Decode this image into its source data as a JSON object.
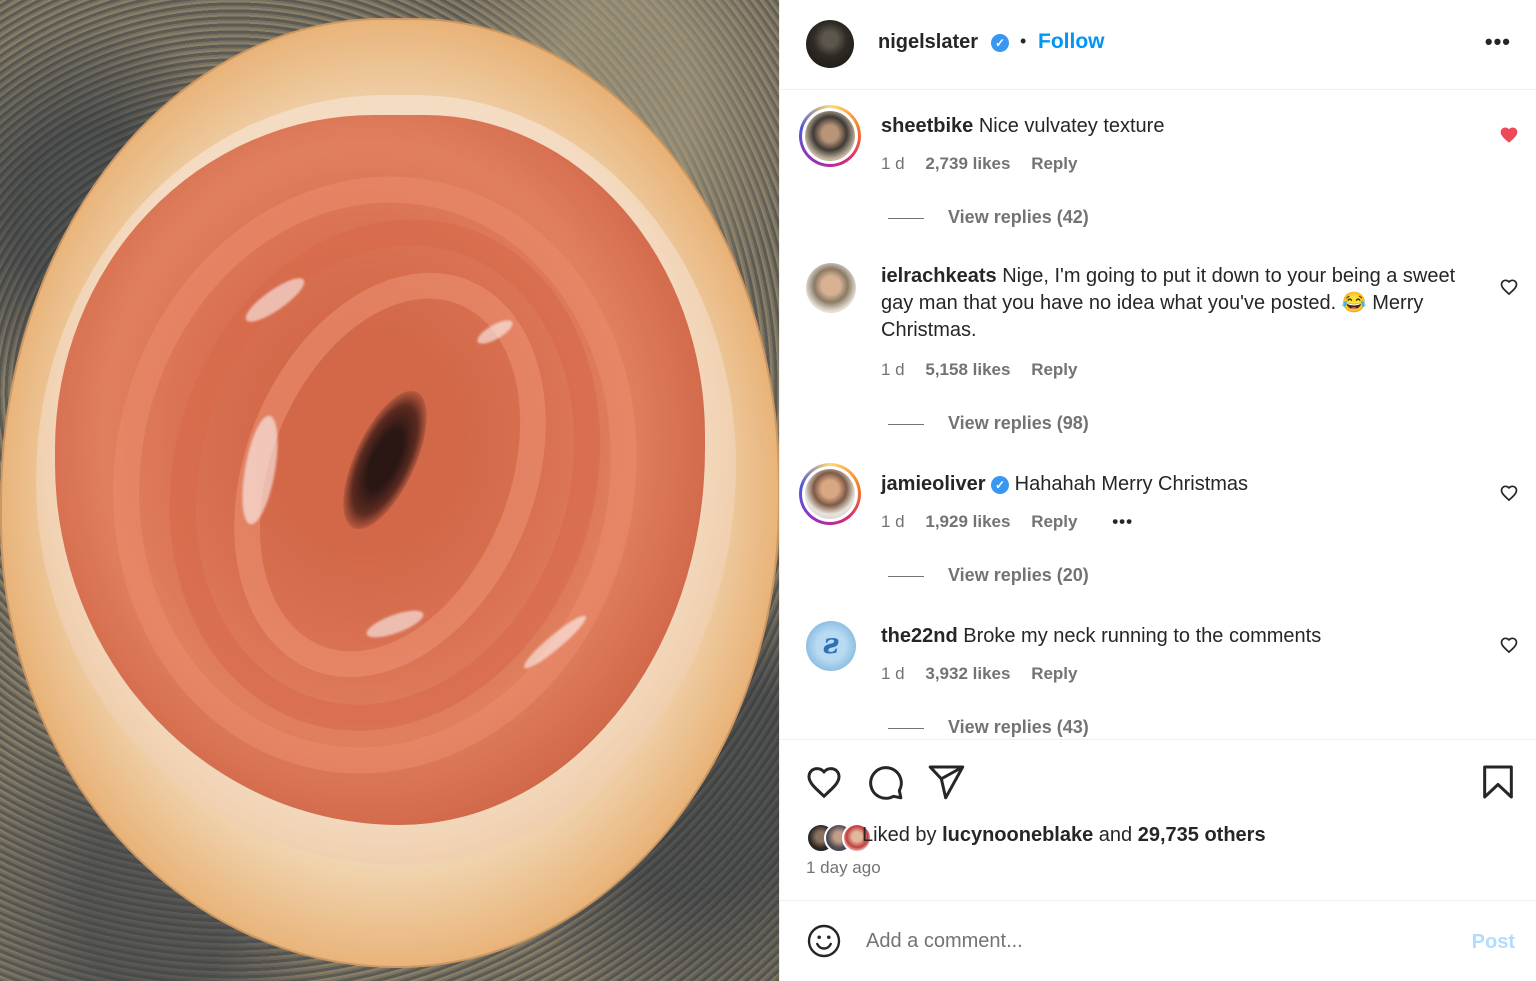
{
  "post": {
    "author": "nigelslater",
    "follow_label": "Follow",
    "separator": "•",
    "more_label": "•••"
  },
  "comments": [
    {
      "username": "sheetbike",
      "text": "Nice vulvatey texture",
      "time": "1 d",
      "likes": "2,739 likes",
      "reply_label": "Reply",
      "view_replies": "View replies (42)",
      "liked": true
    },
    {
      "username": "ielrachkeats",
      "text": "Nige, I'm going to put it down to your being a sweet gay man that you have no idea what you've posted. 😂 Merry Christmas.",
      "time": "1 d",
      "likes": "5,158 likes",
      "reply_label": "Reply",
      "view_replies": "View replies (98)",
      "liked": false
    },
    {
      "username": "jamieoliver",
      "verified": true,
      "text": "Hahahah Merry Christmas",
      "time": "1 d",
      "likes": "1,929 likes",
      "reply_label": "Reply",
      "more_label": "•••",
      "view_replies": "View replies (20)",
      "liked": false
    },
    {
      "username": "the22nd",
      "text": "Broke my neck running to the comments",
      "time": "1 d",
      "likes": "3,932 likes",
      "reply_label": "Reply",
      "view_replies": "View replies (43)",
      "liked": false
    }
  ],
  "likes": {
    "prefix": "Liked by",
    "user": "lucynooneblake",
    "and": "and",
    "others": "29,735 others"
  },
  "posted_ago": "1 day ago",
  "comment_box": {
    "placeholder": "Add a comment...",
    "post_label": "Post"
  },
  "icons": {
    "heart": "heart-icon",
    "comment": "comment-icon",
    "share": "send-icon",
    "save": "bookmark-icon",
    "emoji": "emoji-icon",
    "liked_heart_color": "#ed4956",
    "link_color": "#0095f6",
    "verified_color": "#3897f0"
  }
}
